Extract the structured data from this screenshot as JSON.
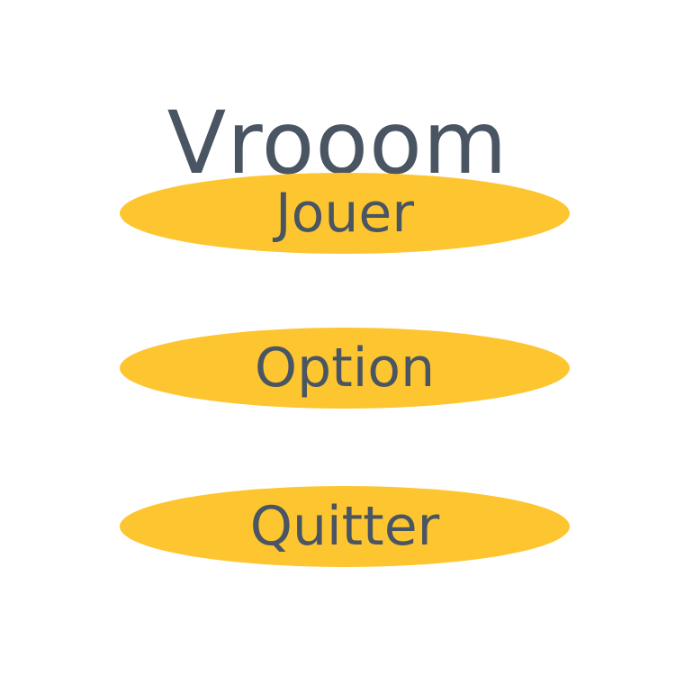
{
  "app": {
    "title": "Vrooom"
  },
  "menu": {
    "play_label": "Jouer",
    "option_label": "Option",
    "quit_label": "Quitter"
  },
  "colors": {
    "accent": "#fdc52f",
    "text": "#4a5563",
    "background": "#ffffff"
  }
}
